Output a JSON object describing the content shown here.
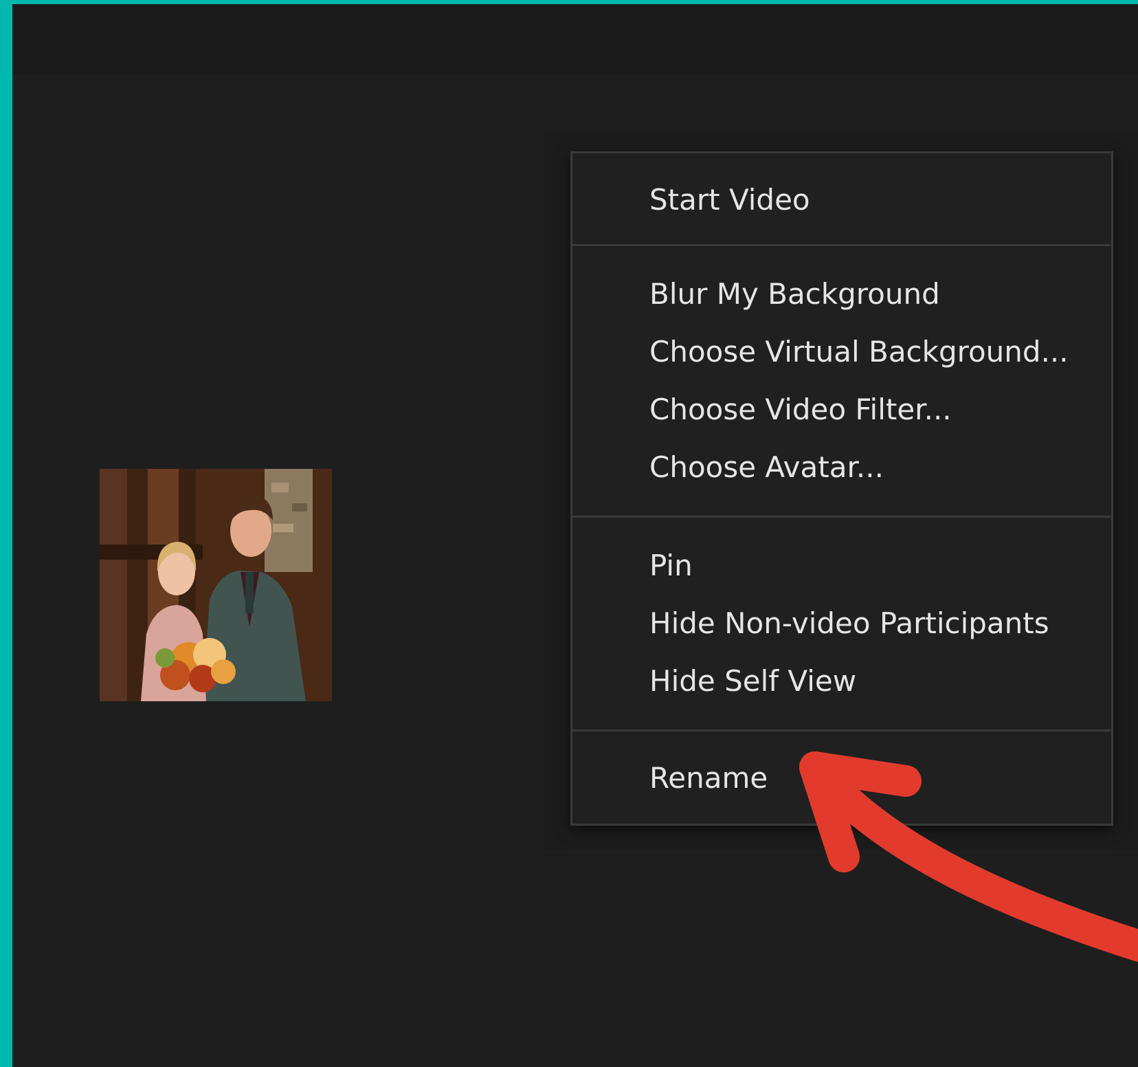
{
  "menu": {
    "groups": [
      {
        "items": [
          {
            "label": "Start Video"
          }
        ]
      },
      {
        "items": [
          {
            "label": "Blur My Background"
          },
          {
            "label": "Choose Virtual Background..."
          },
          {
            "label": "Choose Video Filter..."
          },
          {
            "label": "Choose Avatar..."
          }
        ]
      },
      {
        "items": [
          {
            "label": "Pin"
          },
          {
            "label": "Hide Non-video Participants"
          },
          {
            "label": "Hide Self View"
          }
        ]
      },
      {
        "items": [
          {
            "label": "Rename"
          }
        ]
      }
    ]
  },
  "annotation": {
    "type": "arrow",
    "points_to": "Rename",
    "color": "#e23b2e"
  },
  "colors": {
    "frame_border": "#00b8b0",
    "background": "#1e1e1e",
    "menu_background": "#202020",
    "menu_text": "#e6e6e6"
  }
}
